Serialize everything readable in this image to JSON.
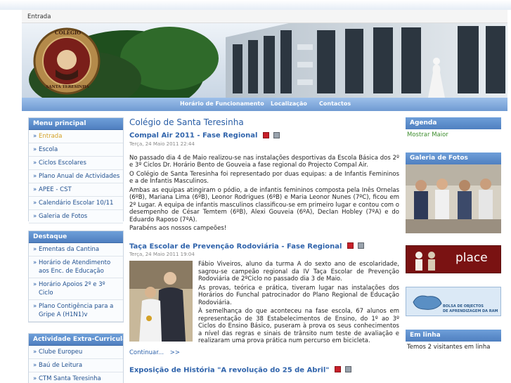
{
  "breadcrumb": {
    "current": "Entrada"
  },
  "banner": {
    "logo_line1": "COLÉGIO",
    "logo_line2": "SANTA TERESINHA"
  },
  "nav": {
    "items": [
      "Horário de Funcionamento",
      "Localização",
      "Contactos"
    ]
  },
  "menu_principal": {
    "title": "Menu principal",
    "items": [
      "Entrada",
      "Escola",
      "Ciclos Escolares",
      "Plano Anual de Actividades",
      "APEE - CST",
      "Calendário Escolar 10/11",
      "Galeria de Fotos"
    ]
  },
  "destaque": {
    "title": "Destaque",
    "items": [
      "Ementas da Cantina",
      "Horário de Atendimento aos Enc. de Educação",
      "Horário Apoios 2º e 3º Ciclo",
      "Plano Contigência para a Gripe A (H1N1)v"
    ]
  },
  "extra": {
    "title": "Actividade Extra-Curricular",
    "items": [
      "Clube Europeu",
      "Baú de Leitura",
      "CTM Santa Teresinha"
    ]
  },
  "main": {
    "heading": "Colégio de Santa Teresinha",
    "articles": [
      {
        "title": "Compal Air 2011 - Fase Regional",
        "date": "Terça, 24 Maio 2011 22:44",
        "paragraphs": [
          "No passado dia 4 de Maio realizou-se nas instalações desportivas da Escola Básica dos 2º e 3º Ciclos Dr. Horário Bento de Gouveia a fase regional do Projecto Compal Air.",
          "O Colégio de Santa Teresinha foi representado por duas equipas: a de Infantis Femininos e a de Infantis Masculinos.",
          "Ambas as equipas atingiram o pódio, a de infantis femininos composta pela Inês Ornelas (6ºB), Mariana Lima (6ºB), Leonor Rodrigues (6ºB) e Maria Leonor Nunes (7ºC), ficou em 2º Lugar. A equipa de infantis masculinos classificou-se em primeiro lugar e contou com o desempenho de César Temtem (6ºB), Alexi Gouveia (6ºA), Declan Hobley (7ºA) e do Eduardo Raposo (7ºA).",
          "Parabéns aos nossos campeões!"
        ]
      },
      {
        "title": "Taça Escolar de Prevenção Rodoviária - Fase Regional",
        "date": "Terça, 24 Maio 2011 19:04",
        "paragraphs": [
          "Fábio Viveiros, aluno da turma A do sexto ano de escolaridade, sagrou-se campeão regional da IV Taça Escolar de Prevenção Rodoviária de 2ºCiclo no passado dia 3 de Maio.",
          "As provas, teórica e prática, tiveram lugar nas instalações dos Horários do Funchal patrocinador do Plano Regional de Educação Rodoviária.",
          "À semelhança do que aconteceu na fase escola, 67 alunos em representação de 38 Estabelecimentos de Ensino, do 1º ao 3º Ciclos do Ensino Básico, puseram à prova os seus conhecimentos a nível das regras e sinais de trânsito num teste de avaliação e realizaram uma prova prática num percurso em bicicleta."
        ],
        "continue": "Continuar...",
        "continue_arrow": ">>"
      },
      {
        "title": "Exposição de História \"A revolução do 25 de Abril\""
      }
    ]
  },
  "right": {
    "agenda": {
      "title": "Agenda",
      "link": "Mostrar Maior"
    },
    "galeria": {
      "title": "Galeria de Fotos"
    },
    "place_banner": "place",
    "bolsa_line1": "BOLSA DE OBJECTOS",
    "bolsa_line2": "DE APRENDIZAGEM DA RAM",
    "online": {
      "title": "Em linha",
      "text": "Temos 2 visitantes em linha"
    }
  },
  "colors": {
    "accent": "#2f63ab",
    "header_blue": "#5b8bcd",
    "active": "#d4a126"
  }
}
